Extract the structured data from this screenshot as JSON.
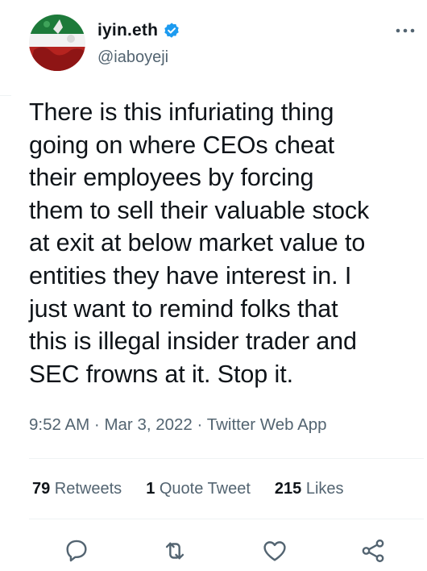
{
  "user": {
    "display_name": "iyin.eth",
    "handle": "@iaboyeji",
    "verified": true
  },
  "tweet": {
    "text": "There is this infuriating thing\ngoing on where CEOs cheat\ntheir employees by forcing\nthem to sell their valuable stock\nat exit at below market value to\nentities they have interest in. I\njust want to remind folks that\nthis is illegal insider trader and\nSEC frowns at it. Stop it."
  },
  "meta": {
    "time": "9:52 AM",
    "sep1": " · ",
    "date": "Mar 3, 2022",
    "sep2": " · ",
    "source": "Twitter Web App"
  },
  "stats": {
    "retweets_count": "79",
    "retweets_label": " Retweets",
    "quotes_count": "1",
    "quotes_label": " Quote Tweet",
    "likes_count": "215",
    "likes_label": " Likes"
  },
  "icons": {
    "reply": "reply-icon",
    "retweet": "retweet-icon",
    "like": "heart-icon",
    "share": "share-icon",
    "more": "more-icon",
    "verified": "verified-badge-icon"
  },
  "colors": {
    "text": "#0f1419",
    "secondary": "#536471",
    "verified": "#1d9bf0",
    "divider": "#eff3f4"
  }
}
